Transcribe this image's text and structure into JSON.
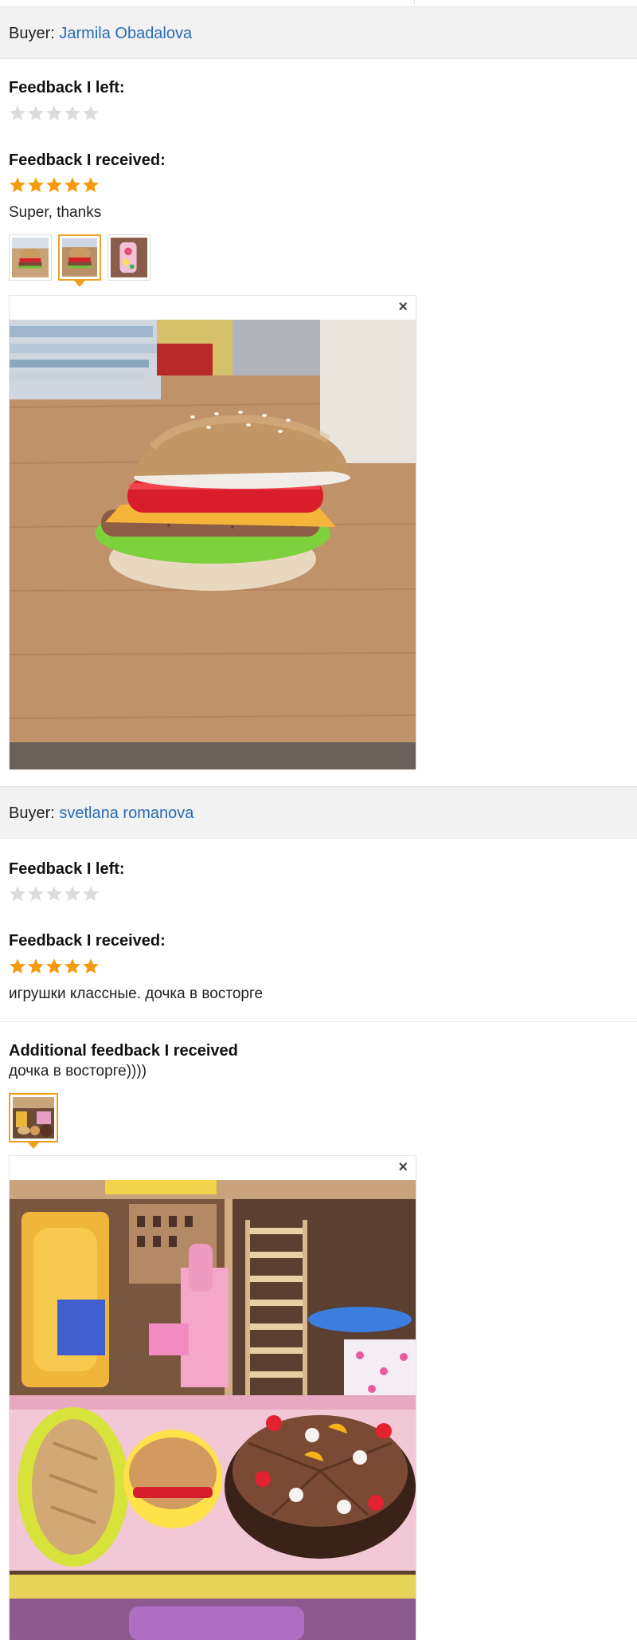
{
  "reviews": [
    {
      "buyer_prefix": "Buyer:",
      "buyer_name": "Jarmila Obadalova",
      "feedback_left_label": "Feedback I left:",
      "feedback_left_stars": 0,
      "feedback_received_label": "Feedback I received:",
      "feedback_received_stars": 5,
      "feedback_text": "Super, thanks",
      "close_symbol": "×"
    },
    {
      "buyer_prefix": "Buyer:",
      "buyer_name": "svetlana romanova",
      "feedback_left_label": "Feedback I left:",
      "feedback_left_stars": 0,
      "feedback_received_label": "Feedback I received:",
      "feedback_received_stars": 5,
      "feedback_text": "игрушки классные. дочка в восторге",
      "additional_label": "Additional feedback I received",
      "additional_text": "дочка в восторге))))",
      "close_symbol": "×"
    }
  ],
  "colors": {
    "star_on": "#f59a0d",
    "star_off": "#dcdcdc",
    "link": "#2a6bb5",
    "thumb_active": "#f0a020",
    "buyer_bar": "#f2f2f2"
  }
}
